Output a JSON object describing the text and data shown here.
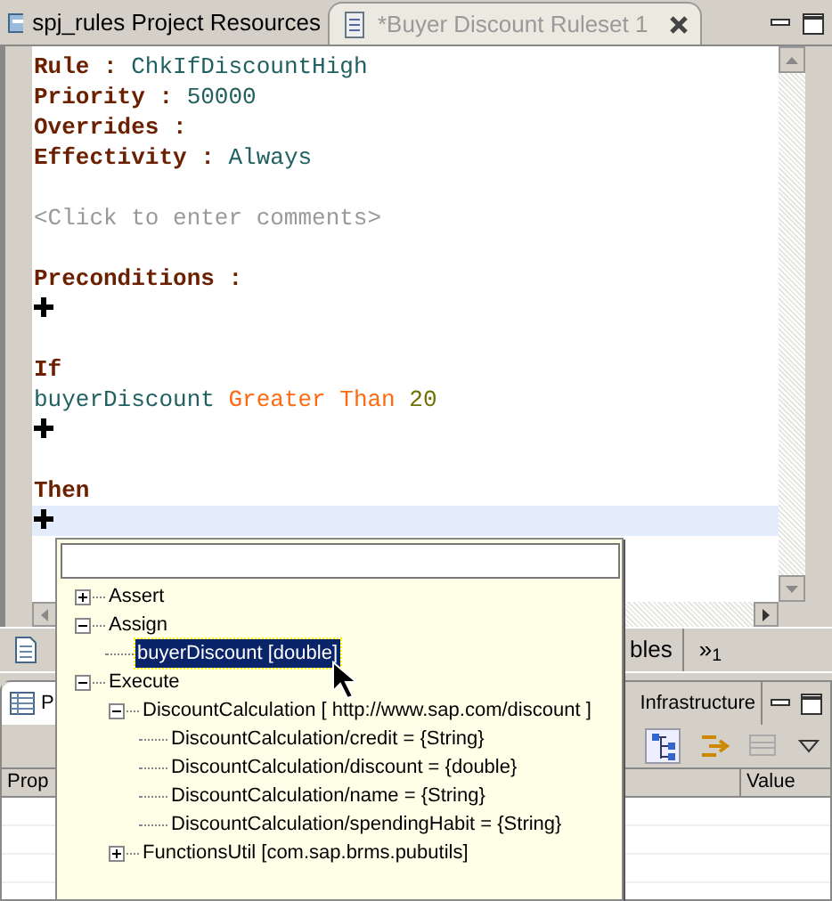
{
  "tabs": [
    {
      "label": "spj_rules Project Resources",
      "selected": false,
      "closable": false
    },
    {
      "label": "*Buyer Discount Ruleset 1",
      "selected": true,
      "closable": true
    }
  ],
  "editor": {
    "lines": [
      {
        "kind": "field",
        "label": "Rule :",
        "value": "ChkIfDiscountHigh",
        "highlighted": false
      },
      {
        "kind": "field",
        "label": "Priority :",
        "value": "50000",
        "highlighted": false
      },
      {
        "kind": "field",
        "label": "Overrides :",
        "highlighted": false
      },
      {
        "kind": "field",
        "label": "Effectivity :",
        "value": "Always",
        "highlighted": false
      },
      {
        "kind": "blank",
        "highlighted": false
      },
      {
        "kind": "comment",
        "text": "<Click to enter comments>",
        "highlighted": false
      },
      {
        "kind": "blank",
        "highlighted": false
      },
      {
        "kind": "heading",
        "text": "Preconditions :",
        "highlighted": false
      },
      {
        "kind": "add",
        "highlighted": false
      },
      {
        "kind": "blank",
        "highlighted": false
      },
      {
        "kind": "heading",
        "text": "If",
        "highlighted": false
      },
      {
        "kind": "condition",
        "subject": "buyerDiscount",
        "operator": "Greater Than",
        "value": "20",
        "highlighted": false
      },
      {
        "kind": "add",
        "highlighted": false
      },
      {
        "kind": "blank",
        "highlighted": false
      },
      {
        "kind": "heading",
        "text": "Then",
        "highlighted": false
      },
      {
        "kind": "add",
        "highlighted": true
      }
    ]
  },
  "editor_tabs": [
    {
      "label": "bles"
    },
    {
      "label": "»$_{1}$"
    }
  ],
  "panel": {
    "tabs": [
      {
        "label": "P",
        "selected": true
      },
      {
        "label": "Infrastructure",
        "selected": false
      }
    ],
    "table": {
      "columns": [
        "Prop",
        "Value"
      ]
    }
  },
  "popup": {
    "tree": [
      {
        "label": "Assert",
        "expanded": false,
        "selected": false
      },
      {
        "label": "Assign",
        "expanded": true,
        "selected": false,
        "children": [
          {
            "label": "buyerDiscount [double]",
            "selected": true
          }
        ]
      },
      {
        "label": "Execute",
        "expanded": true,
        "selected": false,
        "children": [
          {
            "label": "DiscountCalculation [ http://www.sap.com/discount ]",
            "expanded": true,
            "selected": false,
            "children": [
              {
                "label": "DiscountCalculation/credit = {String}",
                "selected": false
              },
              {
                "label": "DiscountCalculation/discount = {double}",
                "selected": false
              },
              {
                "label": "DiscountCalculation/name = {String}",
                "selected": false
              },
              {
                "label": "DiscountCalculation/spendingHabit = {String}",
                "selected": false
              }
            ]
          },
          {
            "label": "FunctionsUtil [com.sap.brms.pubutils]",
            "expanded": false,
            "selected": false
          }
        ]
      }
    ]
  }
}
